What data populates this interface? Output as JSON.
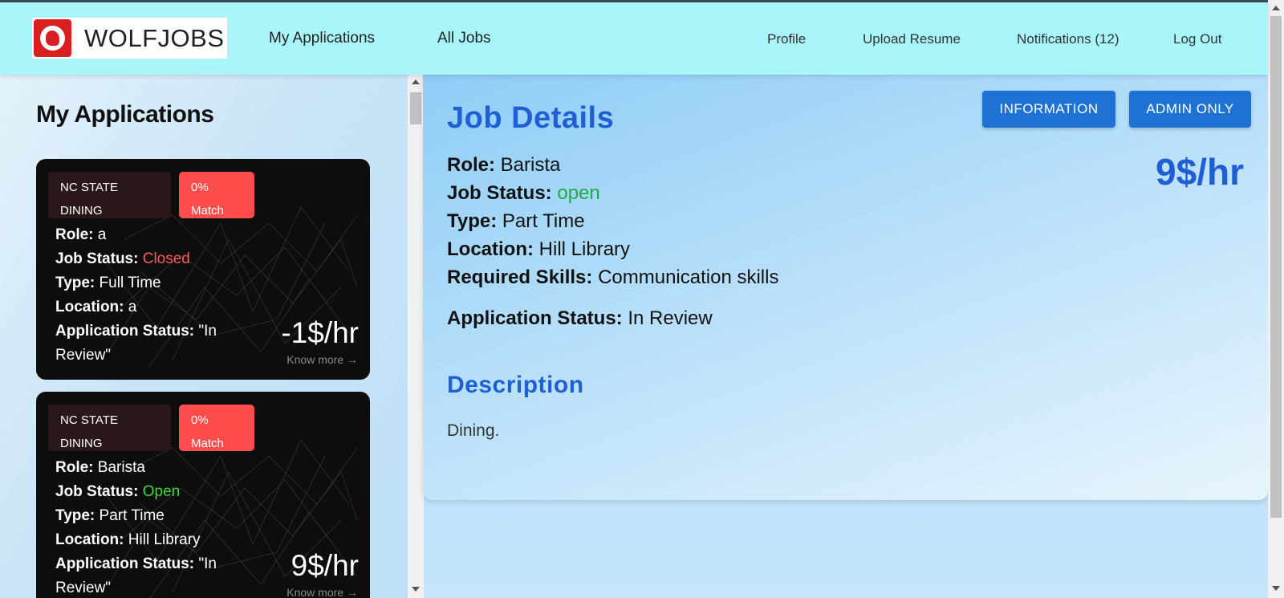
{
  "header": {
    "logo_text": "WOLFJOBS",
    "nav_left": [
      "My Applications",
      "All Jobs"
    ],
    "nav_right": {
      "profile": "Profile",
      "upload_resume": "Upload Resume",
      "notifications": "Notifications (12)",
      "logout": "Log Out"
    }
  },
  "sidebar": {
    "title": "My Applications",
    "cards": [
      {
        "company": "NC STATE DINING",
        "match": "0% Match",
        "role_label": "Role:",
        "role": "a",
        "status_label": "Job Status:",
        "status": "Closed",
        "type_label": "Type:",
        "type": "Full Time",
        "location_label": "Location:",
        "location": "a",
        "app_status_label": "Application Status:",
        "app_status": "\"In Review\"",
        "pay": "-1$/hr",
        "know_more": "Know more →"
      },
      {
        "company": "NC STATE DINING",
        "match": "0% Match",
        "role_label": "Role:",
        "role": "Barista",
        "status_label": "Job Status:",
        "status": "Open",
        "type_label": "Type:",
        "type": "Part Time",
        "location_label": "Location:",
        "location": "Hill Library",
        "app_status_label": "Application Status:",
        "app_status": "\"In Review\"",
        "pay": "9$/hr",
        "know_more": "Know more →"
      }
    ]
  },
  "details": {
    "title": "Job Details",
    "buttons": {
      "information": "INFORMATION",
      "admin_only": "ADMIN ONLY"
    },
    "pay": "9$/hr",
    "role_label": "Role:",
    "role": "Barista",
    "status_label": "Job Status:",
    "status": "open",
    "type_label": "Type:",
    "type": "Part Time",
    "location_label": "Location:",
    "location": "Hill Library",
    "skills_label": "Required Skills:",
    "skills": "Communication skills",
    "app_status_label": "Application Status:",
    "app_status": "In Review",
    "description_title": "Description",
    "description": "Dining."
  },
  "colors": {
    "header_bg": "#a8f5fa",
    "accent_blue": "#1f5fd6",
    "button_blue": "#1d72d4",
    "match_red": "#ff4d4d",
    "closed_red": "#ff5a5a",
    "open_green": "#3bdc3b"
  }
}
